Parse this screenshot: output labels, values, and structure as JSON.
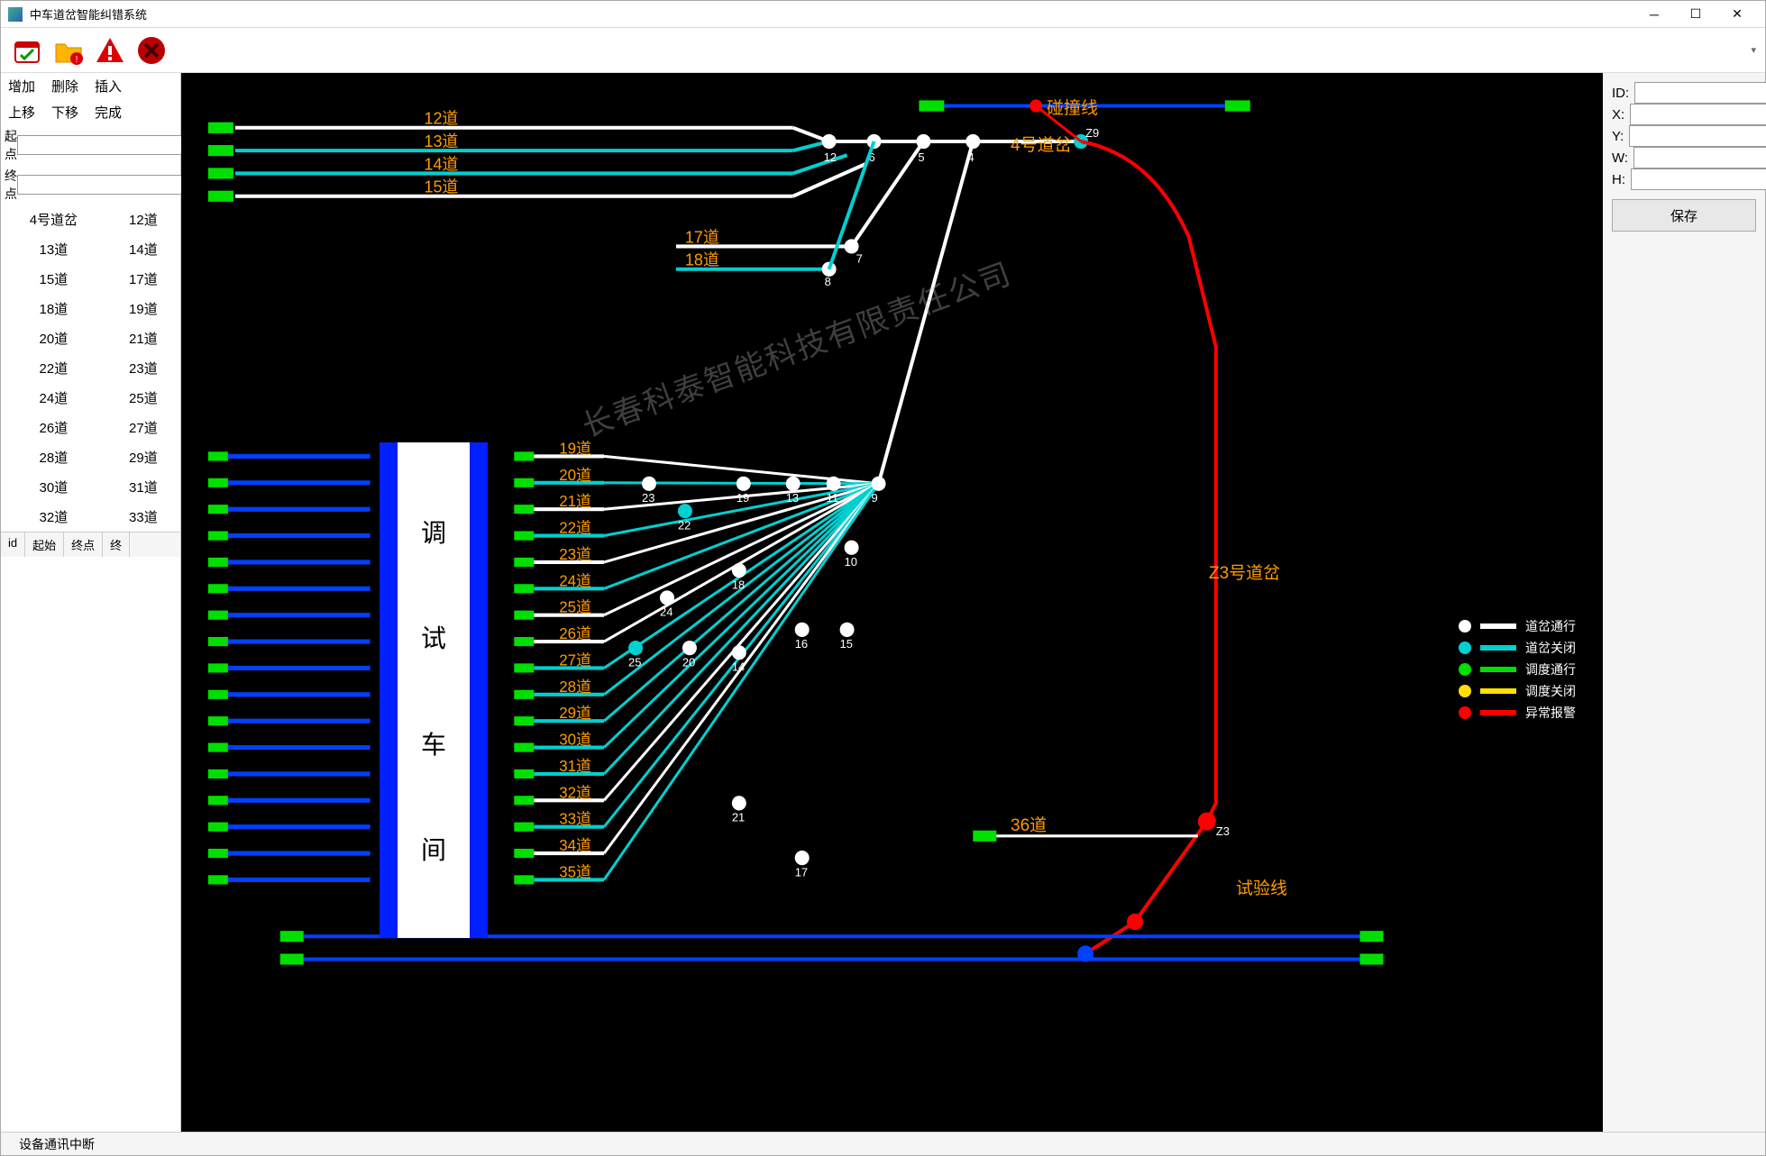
{
  "window": {
    "title": "中车道岔智能纠错系统"
  },
  "toolbar_icons": [
    "calendar-check-icon",
    "folder-alert-icon",
    "warning-icon",
    "close-red-icon"
  ],
  "left": {
    "cmds1": [
      "增加",
      "删除",
      "插入"
    ],
    "cmds2": [
      "上移",
      "下移",
      "完成"
    ],
    "start_label": "起点",
    "end_label": "终点",
    "switch_rows": [
      [
        "4号道岔",
        "12道"
      ],
      [
        "13道",
        "14道"
      ],
      [
        "15道",
        "17道"
      ],
      [
        "18道",
        "19道"
      ],
      [
        "20道",
        "21道"
      ],
      [
        "22道",
        "23道"
      ],
      [
        "24道",
        "25道"
      ],
      [
        "26道",
        "27道"
      ],
      [
        "28道",
        "29道"
      ],
      [
        "30道",
        "31道"
      ],
      [
        "32道",
        "33道"
      ]
    ],
    "table_headers": [
      "id",
      "起始",
      "终点",
      "终"
    ]
  },
  "right": {
    "fields": [
      {
        "label": "ID:",
        "key": "id"
      },
      {
        "label": "X:",
        "key": "x"
      },
      {
        "label": "Y:",
        "key": "y"
      },
      {
        "label": "W:",
        "key": "w"
      },
      {
        "label": "H:",
        "key": "h"
      }
    ],
    "save_btn": "保存"
  },
  "status": {
    "text": "设备通讯中断"
  },
  "canvas": {
    "track_labels_top": [
      "12道",
      "13道",
      "14道",
      "15道",
      "17道",
      "18道"
    ],
    "track_labels_mid": [
      "19道",
      "20道",
      "21道",
      "22道",
      "23道",
      "24道",
      "25道",
      "26道",
      "27道",
      "28道",
      "29道",
      "30道",
      "31道",
      "32道",
      "33道",
      "34道",
      "35道"
    ],
    "depot_chars": [
      "调",
      "试",
      "车",
      "间"
    ],
    "nodes_top": [
      "12",
      "6",
      "5",
      "4",
      "Z9",
      "7",
      "8"
    ],
    "nodes_mid": [
      "23",
      "22",
      "19",
      "13",
      "11",
      "9",
      "18",
      "24",
      "10",
      "25",
      "20",
      "14",
      "16",
      "15",
      "21",
      "17",
      "Z3"
    ],
    "orange_labels": {
      "collision": "碰撞线",
      "sw4": "4号道岔",
      "swZ3": "Z3号道岔",
      "t36": "36道",
      "test": "试验线"
    },
    "watermark": "长春科泰智能科技有限责任公司",
    "legend": [
      {
        "dot": "#ffffff",
        "bar": "#ffffff",
        "label": "道岔通行"
      },
      {
        "dot": "#00d0d0",
        "bar": "#00d0d0",
        "label": "道岔关闭"
      },
      {
        "dot": "#00e000",
        "bar": "#00e000",
        "label": "调度通行"
      },
      {
        "dot": "#ffe000",
        "bar": "#ffe000",
        "label": "调度关闭"
      },
      {
        "dot": "#ff0000",
        "bar": "#ff0000",
        "label": "异常报警"
      }
    ]
  }
}
